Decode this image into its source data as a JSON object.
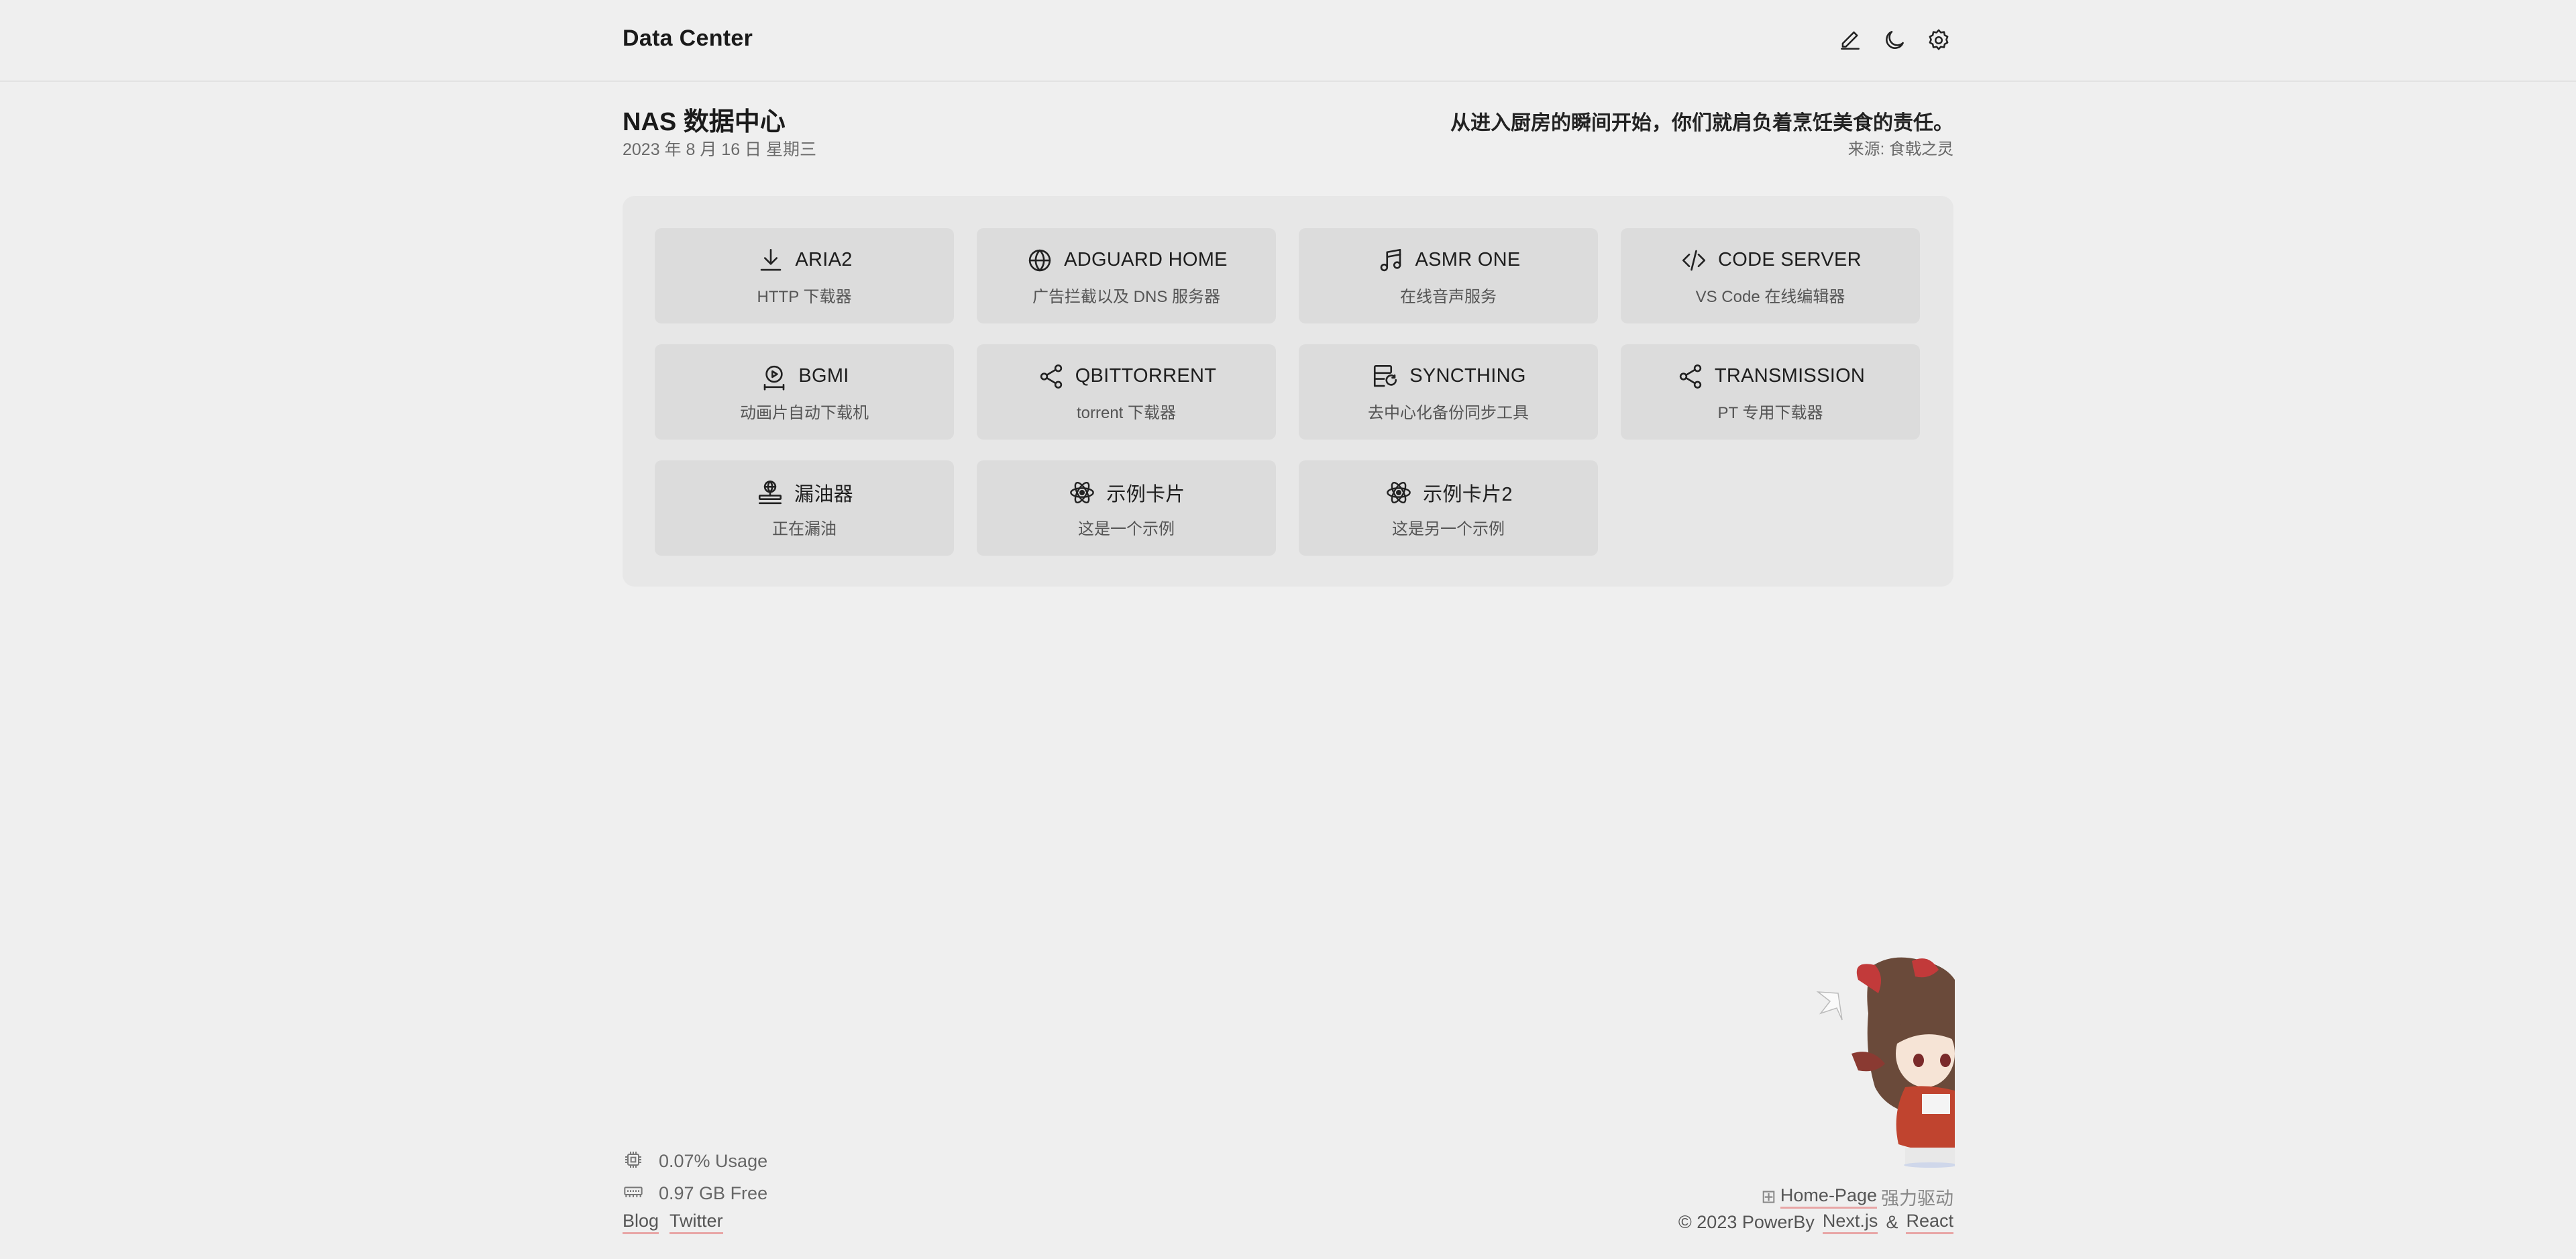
{
  "header": {
    "brand": "Data Center",
    "icons": [
      "edit-icon",
      "moon-icon",
      "gear-icon"
    ]
  },
  "hero": {
    "title": "NAS 数据中心",
    "date": "2023 年 8 月 16 日 星期三",
    "quote": "从进入厨房的瞬间开始，你们就肩负着烹饪美食的责任。",
    "source": "来源: 食戟之灵"
  },
  "cards": [
    {
      "title": "ARIA2",
      "desc": "HTTP 下载器",
      "icon": "download-icon"
    },
    {
      "title": "ADGUARD HOME",
      "desc": "广告拦截以及 DNS 服务器",
      "icon": "globe-icon"
    },
    {
      "title": "ASMR ONE",
      "desc": "在线音声服务",
      "icon": "music-icon"
    },
    {
      "title": "CODE SERVER",
      "desc": "VS Code 在线编辑器",
      "icon": "code-icon"
    },
    {
      "title": "BGMI",
      "desc": "动画片自动下载机",
      "icon": "play-icon"
    },
    {
      "title": "QBITTORRENT",
      "desc": "torrent 下载器",
      "icon": "share-icon"
    },
    {
      "title": "SYNCTHING",
      "desc": "去中心化备份同步工具",
      "icon": "server-sync-icon"
    },
    {
      "title": "TRANSMISSION",
      "desc": "PT 专用下载器",
      "icon": "share-icon"
    },
    {
      "title": "漏油器",
      "desc": "正在漏油",
      "icon": "network-icon"
    },
    {
      "title": "示例卡片",
      "desc": "这是一个示例",
      "icon": "atom-icon"
    },
    {
      "title": "示例卡片2",
      "desc": "这是另一个示例",
      "icon": "atom-icon"
    }
  ],
  "footer": {
    "cpu": "0.07% Usage",
    "memory": "0.97 GB Free",
    "links": [
      "Blog",
      "Twitter"
    ],
    "powered_prefix": "⊞",
    "powered_link": "Home-Page",
    "powered_suffix": "强力驱动",
    "copyright_prefix": "© 2023 PowerBy",
    "nextjs": "Next.js",
    "amp": "&",
    "react": "React"
  }
}
